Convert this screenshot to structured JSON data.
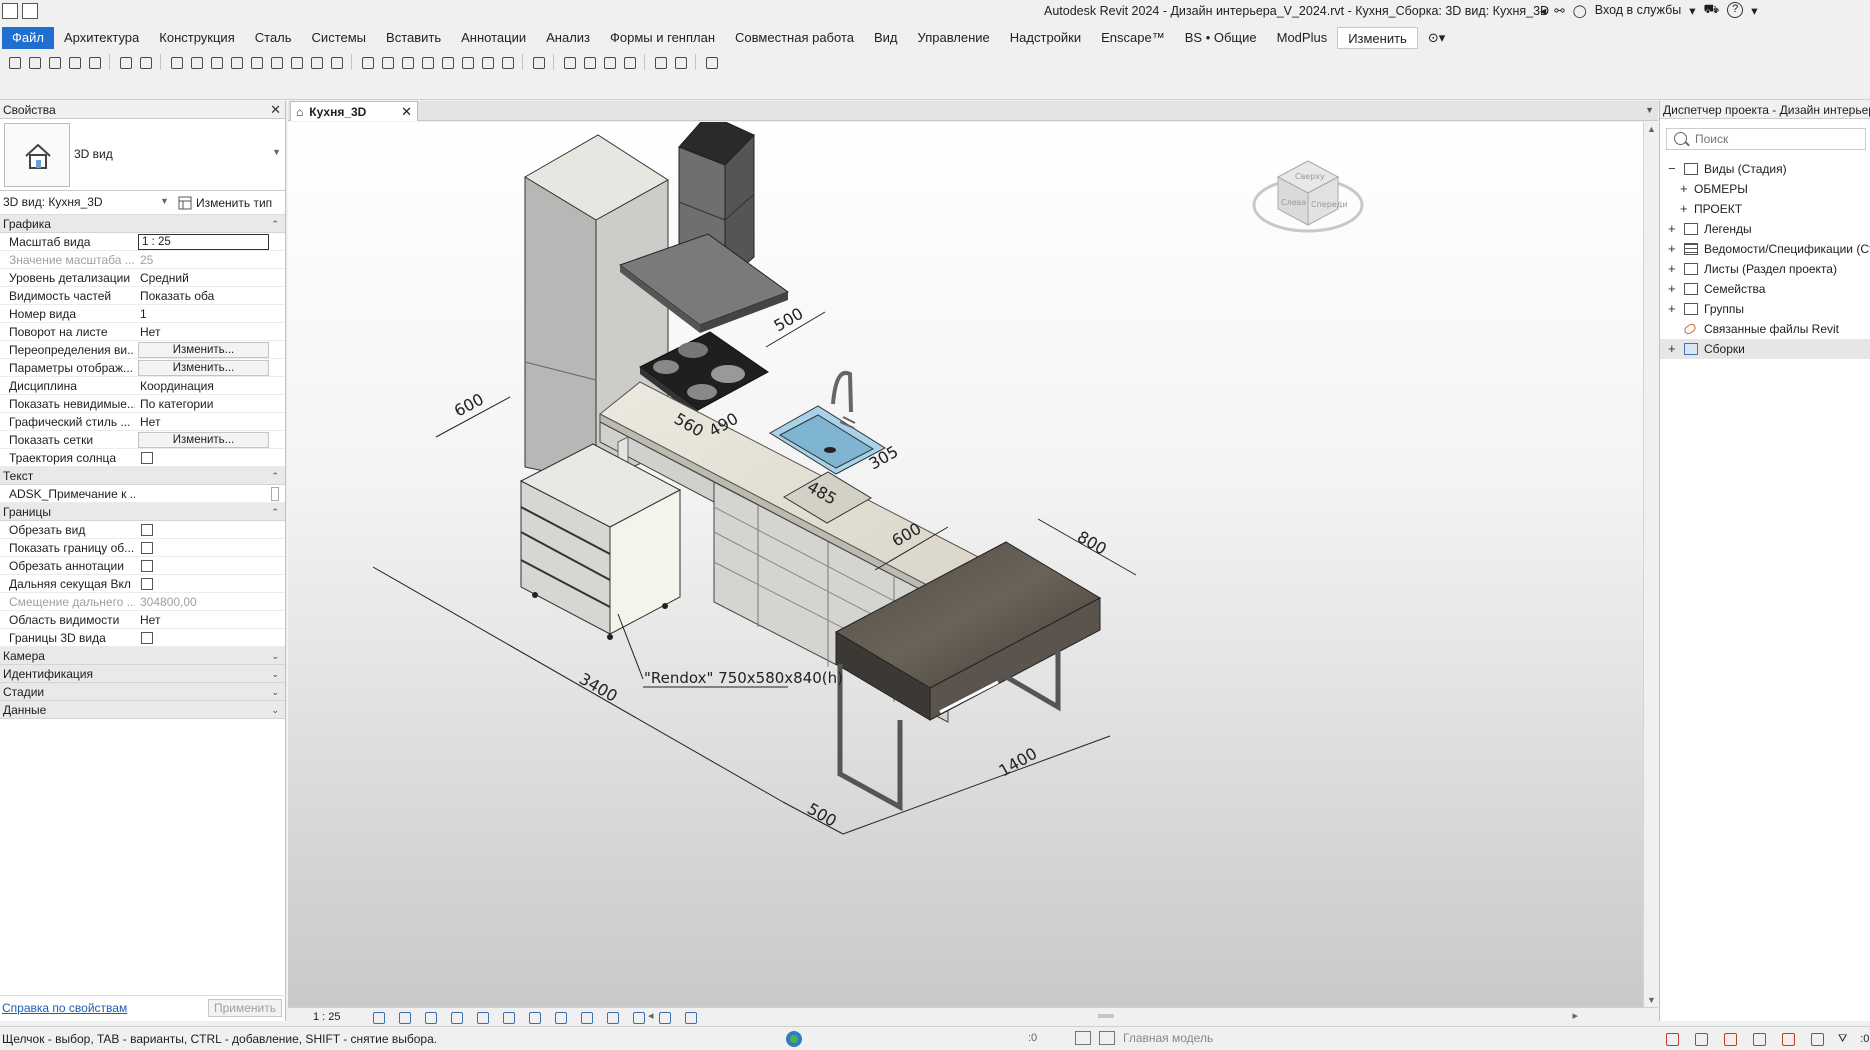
{
  "window": {
    "title": "Autodesk Revit 2024 - Дизайн интерьера_V_2024.rvt - Кухня_Сборка: 3D вид: Кухня_3D",
    "sign_in": "Вход в службы",
    "help": "?"
  },
  "ribbon": {
    "tabs": [
      {
        "label": "Файл"
      },
      {
        "label": "Архитектура"
      },
      {
        "label": "Конструкция"
      },
      {
        "label": "Сталь"
      },
      {
        "label": "Системы"
      },
      {
        "label": "Вставить"
      },
      {
        "label": "Аннотации"
      },
      {
        "label": "Анализ"
      },
      {
        "label": "Формы и генплан"
      },
      {
        "label": "Совместная работа"
      },
      {
        "label": "Вид"
      },
      {
        "label": "Управление"
      },
      {
        "label": "Надстройки"
      },
      {
        "label": "Enscape™"
      },
      {
        "label": "BS • Общие"
      },
      {
        "label": "ModPlus"
      },
      {
        "label": "Изменить"
      }
    ],
    "active_tab": "Изменить"
  },
  "properties": {
    "title": "Свойства",
    "type_name": "3D вид",
    "instance_selector": "3D вид: Кухня_3D",
    "edit_type": "Изменить тип",
    "groups": {
      "graphics": "Графика",
      "text": "Текст",
      "extents": "Границы",
      "camera": "Камера",
      "identity": "Идентификация",
      "phasing": "Стадии",
      "data": "Данные"
    },
    "graphics_rows": [
      {
        "key": "Масштаб вида",
        "value": "1 : 25"
      },
      {
        "key": "Значение масштаба ...",
        "value": "25"
      },
      {
        "key": "Уровень детализации",
        "value": "Средний"
      },
      {
        "key": "Видимость частей",
        "value": "Показать оба"
      },
      {
        "key": "Номер вида",
        "value": "1"
      },
      {
        "key": "Поворот на листе",
        "value": "Нет"
      },
      {
        "key": "Переопределения ви...",
        "value": "Изменить..."
      },
      {
        "key": "Параметры отображ...",
        "value": "Изменить..."
      },
      {
        "key": "Дисциплина",
        "value": "Координация"
      },
      {
        "key": "Показать невидимые...",
        "value": "По категории"
      },
      {
        "key": "Графический стиль ...",
        "value": "Нет"
      },
      {
        "key": "Показать сетки",
        "value": "Изменить..."
      },
      {
        "key": "Траектория солнца",
        "value": ""
      }
    ],
    "text_rows": [
      {
        "key": "ADSK_Примечание к ...",
        "value": ""
      }
    ],
    "extents_rows": [
      {
        "key": "Обрезать вид",
        "value": ""
      },
      {
        "key": "Показать границу об...",
        "value": ""
      },
      {
        "key": "Обрезать аннотации",
        "value": ""
      },
      {
        "key": "Дальняя секущая Вкл",
        "value": ""
      },
      {
        "key": "Смещение дальнего ...",
        "value": "304800,00"
      },
      {
        "key": "Область видимости",
        "value": "Нет"
      },
      {
        "key": "Границы 3D вида",
        "value": ""
      }
    ],
    "help_link": "Справка по свойствам",
    "apply": "Применить"
  },
  "view": {
    "tab_label": "Кухня_3D",
    "scale": "1 : 25",
    "viewcube": {
      "top": "Сверху",
      "left": "Слева",
      "front": "Спереди"
    },
    "dimensions": [
      "600",
      "500",
      "560",
      "490",
      "305",
      "485",
      "600",
      "800",
      "3400",
      "500",
      "1400"
    ],
    "callout": "\"Rendox\" 750x580x840(h)"
  },
  "project_browser": {
    "title": "Диспетчер проекта - Дизайн интерьера",
    "search_placeholder": "Поиск",
    "nodes": [
      {
        "label": "Виды (Стадия)",
        "level": 0,
        "exp": "−"
      },
      {
        "label": "ОБМЕРЫ",
        "level": 1,
        "exp": "+"
      },
      {
        "label": "ПРОЕКТ",
        "level": 1,
        "exp": "+"
      },
      {
        "label": "Легенды",
        "level": 0,
        "exp": "+"
      },
      {
        "label": "Ведомости/Спецификации (Ст",
        "level": 0,
        "exp": "+"
      },
      {
        "label": "Листы (Раздел проекта)",
        "level": 0,
        "exp": "+"
      },
      {
        "label": "Семейства",
        "level": 0,
        "exp": "+"
      },
      {
        "label": "Группы",
        "level": 0,
        "exp": "+"
      },
      {
        "label": "Связанные файлы Revit",
        "level": 0,
        "exp": ""
      },
      {
        "label": "Сборки",
        "level": 0,
        "exp": "+"
      }
    ]
  },
  "status_bar": {
    "message": "Щелчок - выбор, TAB - варианты, CTRL - добавление, SHIFT - снятие выбора.",
    "selection_count": ":0",
    "model": "Главная модель",
    "filter_count": ":0"
  }
}
